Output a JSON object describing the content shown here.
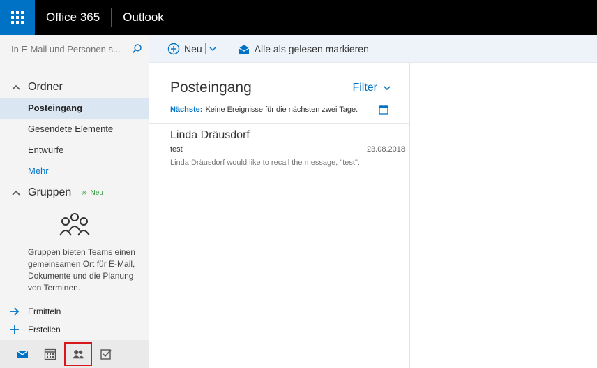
{
  "topbar": {
    "brand": "Office 365",
    "app": "Outlook"
  },
  "search": {
    "placeholder": "In E-Mail und Personen s..."
  },
  "commands": {
    "new_label": "Neu",
    "mark_read_label": "Alle als gelesen markieren"
  },
  "folders": {
    "section_title": "Ordner",
    "items": [
      {
        "label": "Posteingang",
        "active": true
      },
      {
        "label": "Gesendete Elemente"
      },
      {
        "label": "Entwürfe"
      },
      {
        "label": "Mehr"
      }
    ]
  },
  "groups": {
    "section_title": "Gruppen",
    "new_badge": "Neu",
    "description": "Gruppen bieten Teams einen gemeinsamen Ort für E-Mail, Dokumente und die Planung von Terminen.",
    "actions": [
      {
        "label": "Ermitteln",
        "icon": "arrow-right-icon"
      },
      {
        "label": "Erstellen",
        "icon": "plus-icon"
      }
    ]
  },
  "bottom_nav": [
    {
      "icon": "mail-icon"
    },
    {
      "icon": "calendar-icon"
    },
    {
      "icon": "people-icon",
      "highlighted": true
    },
    {
      "icon": "tasks-icon"
    }
  ],
  "message_list": {
    "title": "Posteingang",
    "filter_label": "Filter",
    "next_label": "Nächste:",
    "next_text": "Keine Ereignisse für die nächsten zwei Tage.",
    "messages": [
      {
        "from": "Linda Dräusdorf",
        "subject": "test",
        "date": "23.08.2018",
        "preview": "Linda Dräusdorf would like to recall the message, \"test\"."
      }
    ]
  },
  "colors": {
    "accent": "#0072c6",
    "topbar": "#000000",
    "left_pane": "#f4f4f4",
    "active_folder": "#dbe6f3",
    "new_badge": "#2e9b3a",
    "highlight_border": "#d8171c"
  }
}
